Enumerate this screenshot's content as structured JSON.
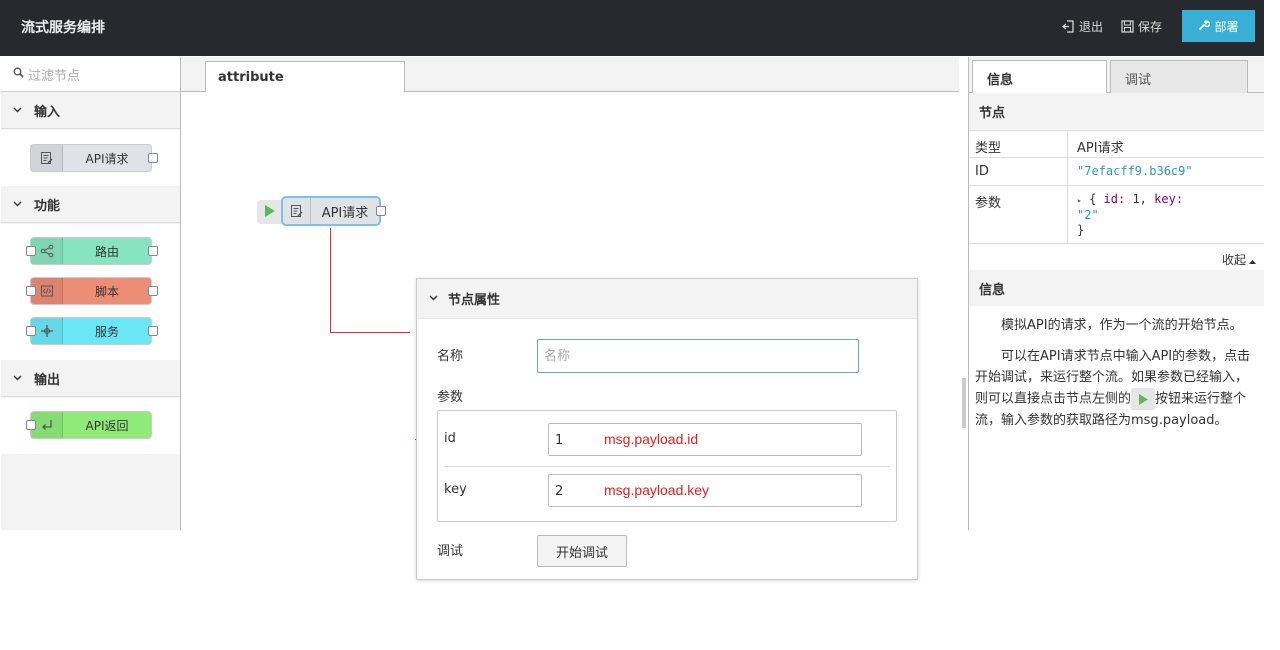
{
  "header": {
    "title": "流式服务编排",
    "logout_label": "退出",
    "save_label": "保存",
    "deploy_label": "部署"
  },
  "palette": {
    "filter_placeholder": "过滤节点",
    "categories": [
      {
        "label": "输入",
        "nodes": [
          {
            "label": "API请求",
            "color": "#dfe2e6"
          }
        ]
      },
      {
        "label": "功能",
        "nodes": [
          {
            "label": "路由",
            "color": "#87e3c1"
          },
          {
            "label": "脚本",
            "color": "#ec8d75"
          },
          {
            "label": "服务",
            "color": "#6be6f5"
          }
        ]
      },
      {
        "label": "输出",
        "nodes": [
          {
            "label": "API返回",
            "color": "#8fea7a"
          }
        ]
      }
    ]
  },
  "workspace": {
    "tab_label": "attribute",
    "flow_node_label": "API请求"
  },
  "properties": {
    "section_title": "节点属性",
    "name_label": "名称",
    "name_placeholder": "名称",
    "params_label": "参数",
    "params": [
      {
        "key": "id",
        "value": "1",
        "annotation": "msg.payload.id"
      },
      {
        "key": "key",
        "value": "2",
        "annotation": "msg.payload.key"
      }
    ],
    "debug_label": "调试",
    "debug_button": "开始调试"
  },
  "sidebar": {
    "tabs": [
      "信息",
      "调试"
    ],
    "node_section": "节点",
    "rows": {
      "type_label": "类型",
      "type_value": "API请求",
      "id_label": "ID",
      "id_value": "\"7efacff9.b36c9\"",
      "params_label": "参数",
      "params_line1_brace": "{",
      "params_key1": "id:",
      "params_val1": "1,",
      "params_key2": "key:",
      "params_val2": "\"2\"",
      "params_close": "}"
    },
    "collapse_label": "收起",
    "info_section": "信息",
    "info_p1": "模拟API的请求，作为一个流的开始节点。",
    "info_p2_a": "可以在API请求节点中输入API的参数，点击开始调试，来运行整个流。如果参数已经输入，则可以直接点击节点左侧的",
    "info_p2_b": "按钮来运行整个流，输入参数的获取路径为msg.payload。"
  },
  "colors": {
    "header_bg": "#262a2e",
    "deploy_bg": "#39afd6",
    "annotation_red": "#e0201c",
    "play_green": "#5cb85c"
  }
}
